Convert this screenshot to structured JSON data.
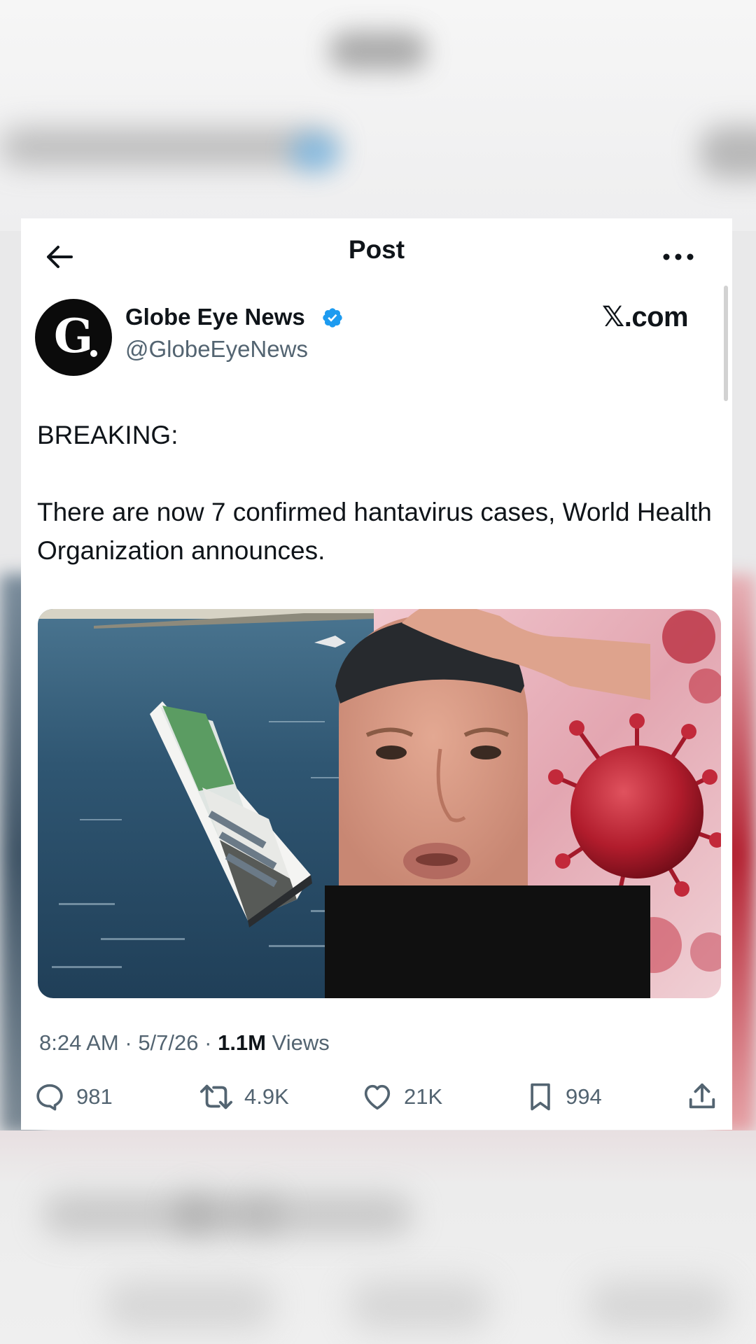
{
  "header": {
    "title": "Post"
  },
  "author": {
    "avatar_letter": "G",
    "name": "Globe Eye News",
    "handle": "@GlobeEyeNews",
    "verified": true
  },
  "watermark": "𝕏.com",
  "tweet": {
    "line1": "BREAKING:",
    "line2": "There are now 7 confirmed hantavirus cases, World Health Organization announces."
  },
  "meta": {
    "time": "8:24 AM",
    "date": "5/7/26",
    "views_count": "1.1M",
    "views_label": "Views"
  },
  "actions": {
    "replies": "981",
    "reposts": "4.9K",
    "likes": "21K",
    "bookmarks": "994"
  },
  "colors": {
    "verified_blue": "#1d9bf0",
    "text_primary": "#0f1419",
    "text_secondary": "#536471"
  }
}
